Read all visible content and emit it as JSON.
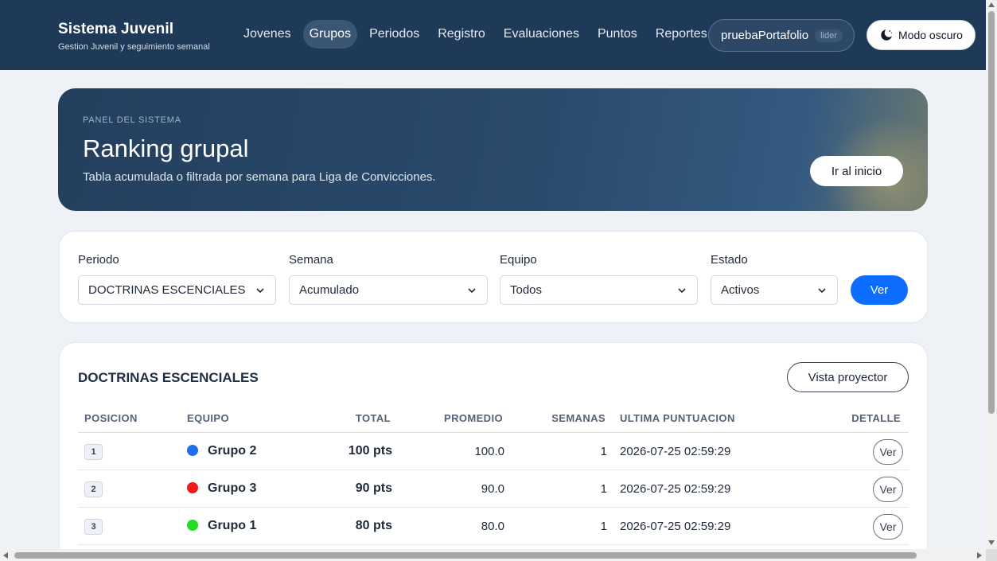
{
  "brand": {
    "title": "Sistema Juvenil",
    "subtitle": "Gestion Juvenil y seguimiento semanal"
  },
  "nav": {
    "items": [
      {
        "label": "Jovenes",
        "active": false
      },
      {
        "label": "Grupos",
        "active": true
      },
      {
        "label": "Periodos",
        "active": false
      },
      {
        "label": "Registro",
        "active": false
      },
      {
        "label": "Evaluaciones",
        "active": false
      },
      {
        "label": "Puntos",
        "active": false
      },
      {
        "label": "Reportes",
        "active": false
      }
    ],
    "user": "pruebaPortafolio",
    "role": "lider",
    "dark_mode_label": "Modo oscuro",
    "dark_mode_icon": "moon-icon"
  },
  "hero": {
    "kicker": "PANEL DEL SISTEMA",
    "title": "Ranking grupal",
    "description": "Tabla acumulada o filtrada por semana para Liga de Convicciones.",
    "home_button": "Ir al inicio"
  },
  "filters": {
    "periodo": {
      "label": "Periodo",
      "value": "DOCTRINAS ESCENCIALES"
    },
    "semana": {
      "label": "Semana",
      "value": "Acumulado"
    },
    "equipo": {
      "label": "Equipo",
      "value": "Todos"
    },
    "estado": {
      "label": "Estado",
      "value": "Activos"
    },
    "submit_label": "Ver"
  },
  "ranking": {
    "title": "DOCTRINAS ESCENCIALES",
    "projector_button": "Vista proyector",
    "columns": [
      "POSICION",
      "EQUIPO",
      "TOTAL",
      "PROMEDIO",
      "SEMANAS",
      "ULTIMA PUNTUACION",
      "DETALLE"
    ],
    "rows": [
      {
        "position": "1",
        "team": "Grupo 2",
        "color": "#1f6feb",
        "total": "100 pts",
        "average": "100.0",
        "weeks": "1",
        "last_score": "2026-07-25 02:59:29",
        "detail": "Ver"
      },
      {
        "position": "2",
        "team": "Grupo 3",
        "color": "#ee1c1c",
        "total": "90 pts",
        "average": "90.0",
        "weeks": "1",
        "last_score": "2026-07-25 02:59:29",
        "detail": "Ver"
      },
      {
        "position": "3",
        "team": "Grupo 1",
        "color": "#22dd22",
        "total": "80 pts",
        "average": "80.0",
        "weeks": "1",
        "last_score": "2026-07-25 02:59:29",
        "detail": "Ver"
      }
    ]
  }
}
